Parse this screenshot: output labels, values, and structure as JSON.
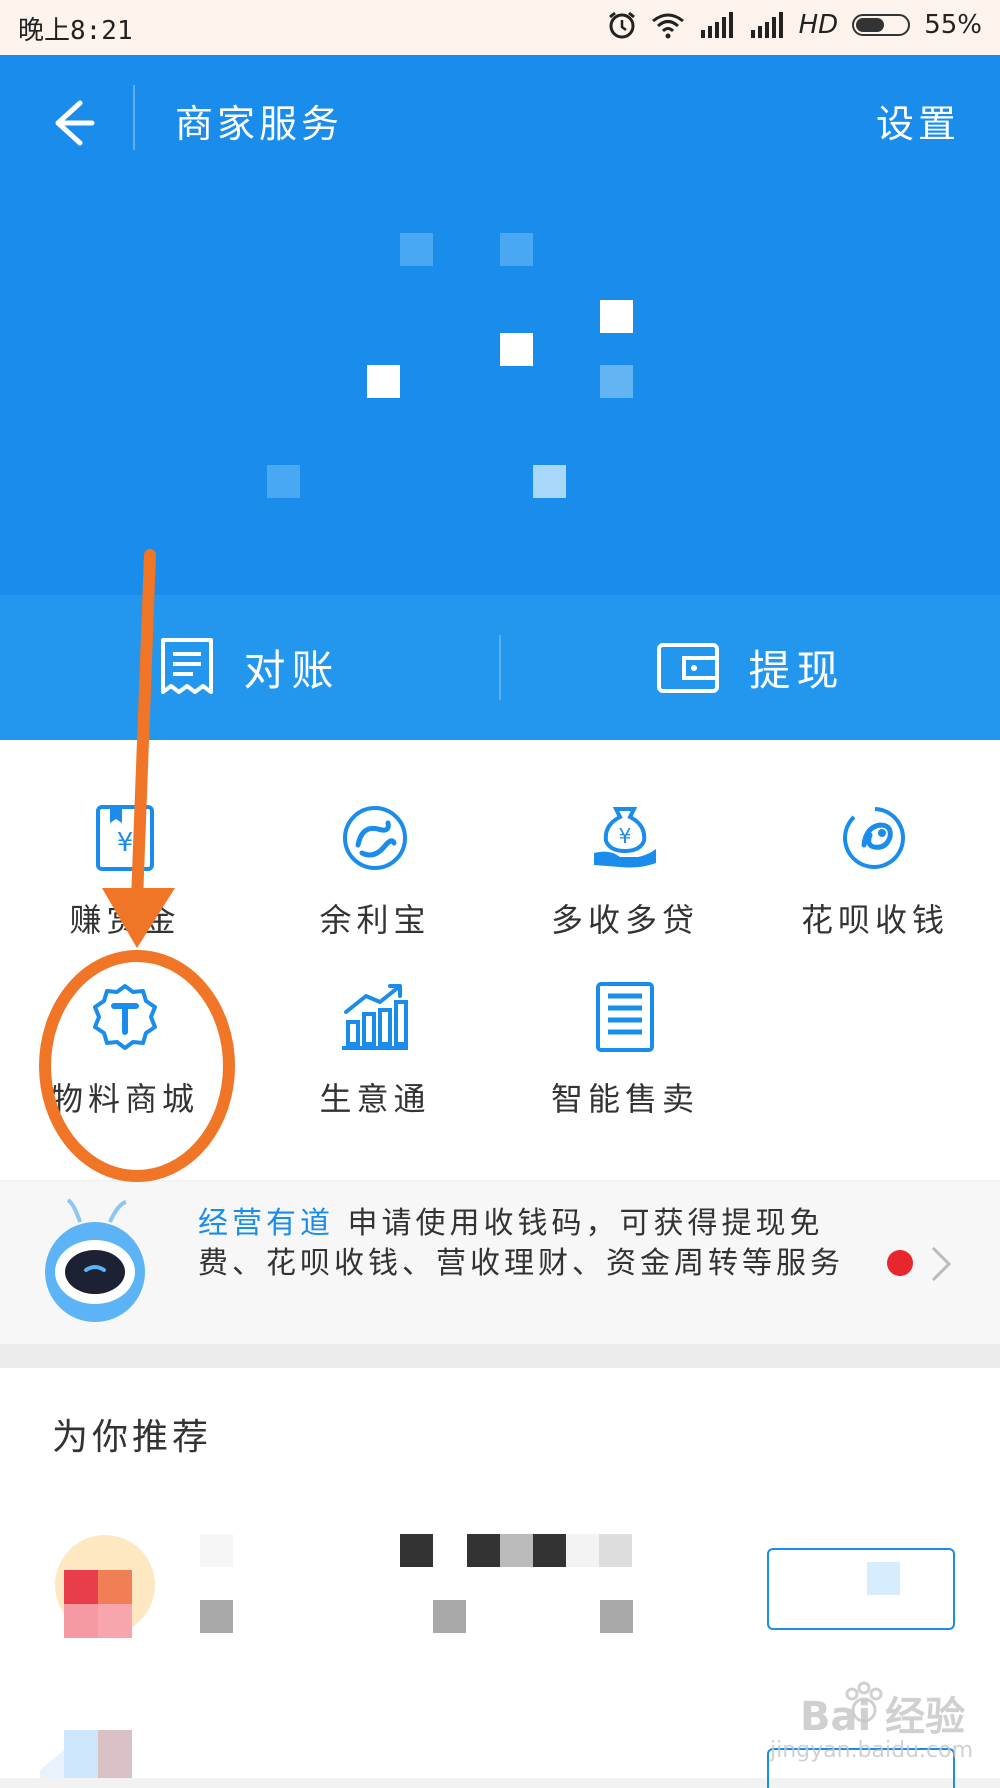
{
  "status_bar": {
    "time": "晚上8:21",
    "network": "HD",
    "battery_percent": "55%",
    "battery_level": 0.55
  },
  "header": {
    "title": "商家服务",
    "settings_label": "设置",
    "back_icon": "arrow-left-icon"
  },
  "actions": [
    {
      "label": "对账",
      "icon": "receipt-icon"
    },
    {
      "label": "提现",
      "icon": "wallet-icon"
    }
  ],
  "services": [
    {
      "label": "赚赏金",
      "icon": "reward-card-icon"
    },
    {
      "label": "余利宝",
      "icon": "yulibao-icon"
    },
    {
      "label": "多收多贷",
      "icon": "money-bag-hand-icon"
    },
    {
      "label": "花呗收钱",
      "icon": "huabei-icon"
    },
    {
      "label": "物料商城",
      "icon": "t-badge-icon"
    },
    {
      "label": "生意通",
      "icon": "bar-chart-icon"
    },
    {
      "label": "智能售卖",
      "icon": "vending-icon"
    }
  ],
  "banner": {
    "highlight": "经营有道",
    "text": " 申请使用收钱码，可获得提现免费、花呗收钱、营收理财、资金周转等服务"
  },
  "recommend": {
    "title": "为你推荐"
  },
  "watermark": {
    "brand": "Bai 经验",
    "url": "jingyan.baidu.com"
  },
  "colors": {
    "primary": "#1a8ceb",
    "action_bar": "#2397ee",
    "annotation": "#f07526",
    "badge_red": "#e8262d"
  }
}
